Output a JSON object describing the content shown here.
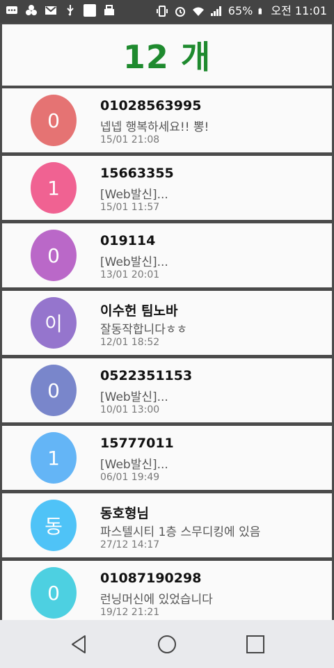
{
  "status_bar": {
    "battery": "65%",
    "time": "오전 11:01"
  },
  "header": {
    "count_label": "12 개"
  },
  "messages": [
    {
      "avatar": "0",
      "color": "#e57373",
      "title": "01028563995",
      "message": "넵넵 행복하세요!!  뽕!",
      "time": "15/01 21:08"
    },
    {
      "avatar": "1",
      "color": "#f06292",
      "title": "15663355",
      "message": "[Web발신]...",
      "time": "15/01 11:57"
    },
    {
      "avatar": "0",
      "color": "#ba68c8",
      "title": "019114",
      "message": "[Web발신]...",
      "time": "13/01 20:01"
    },
    {
      "avatar": "이",
      "color": "#9575cd",
      "title": "이수헌 팀노바",
      "message": "잘동작합니다ㅎㅎ",
      "time": "12/01 18:52"
    },
    {
      "avatar": "0",
      "color": "#7986cb",
      "title": "0522351153",
      "message": "[Web발신]...",
      "time": "10/01 13:00"
    },
    {
      "avatar": "1",
      "color": "#64b5f6",
      "title": "15777011",
      "message": "[Web발신]...",
      "time": "06/01 19:49"
    },
    {
      "avatar": "동",
      "color": "#4fc3f7",
      "title": "동호형님",
      "message": "파스텔시티 1층 스무디킹에 있음",
      "time": "27/12 14:17"
    },
    {
      "avatar": "0",
      "color": "#4dd0e1",
      "title": "01087190298",
      "message": "런닝머신에 있었습니다",
      "time": "19/12 21:21"
    }
  ],
  "icons": {
    "back": "back-triangle-icon",
    "home": "home-circle-icon",
    "recent": "recent-apps-square-icon"
  }
}
